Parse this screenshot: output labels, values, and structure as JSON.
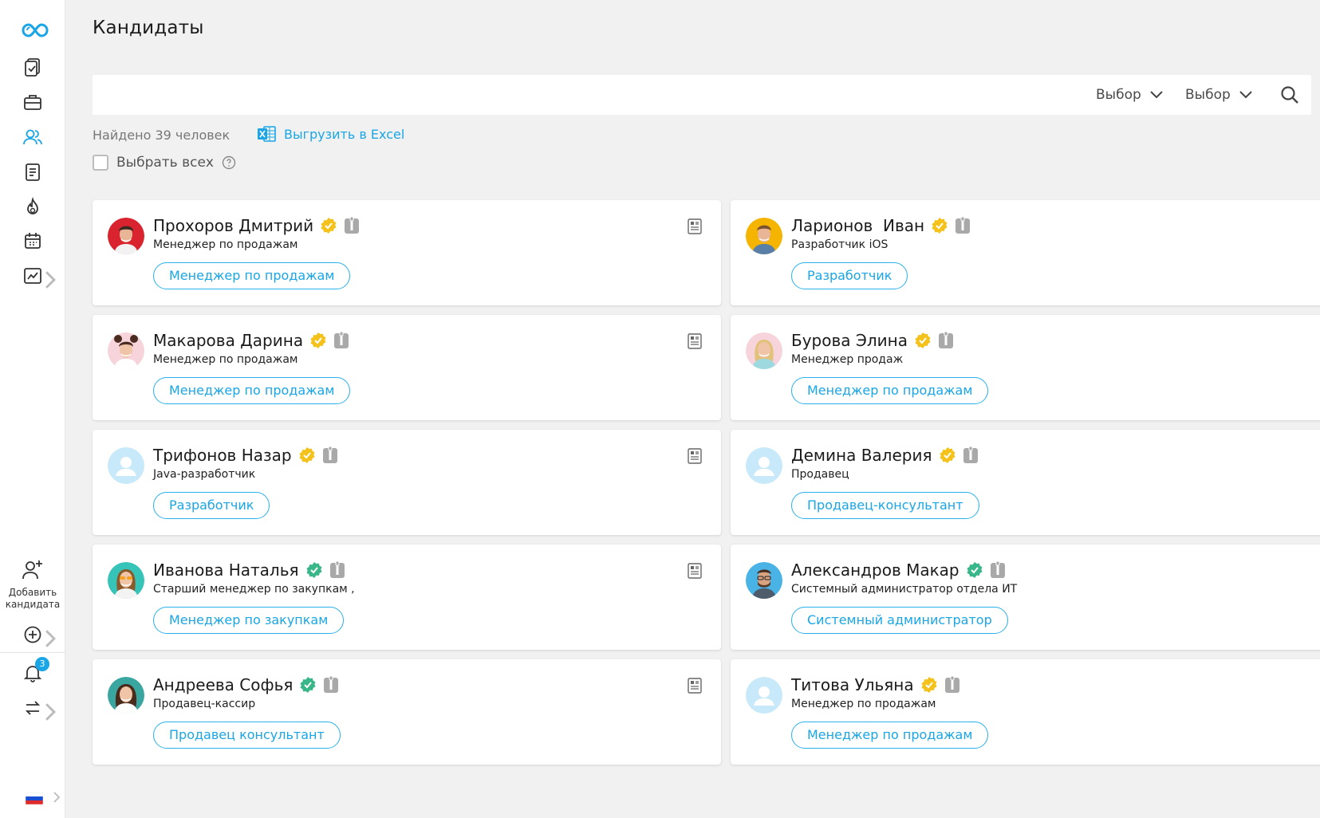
{
  "page": {
    "title": "Кандидаты"
  },
  "search": {
    "placeholder": "",
    "select1": "Выбор",
    "select2": "Выбор"
  },
  "results": {
    "found_text": "Найдено 39 человек",
    "export_label": "Выгрузить в Excel",
    "select_all_label": "Выбрать всех"
  },
  "sidebar": {
    "add_candidate_line1": "Добавить",
    "add_candidate_line2": "кандидата",
    "notifications_count": "3",
    "icons": [
      "logo-icon",
      "documents-icon",
      "briefcase-icon",
      "candidates-icon",
      "file-icon",
      "hot-icon",
      "calendar-icon",
      "analytics-icon"
    ]
  },
  "colors": {
    "accent": "#1aa6e6",
    "gold_badge": "#f4c21b",
    "green_badge": "#3ab78a",
    "background": "#f1f1f1"
  },
  "candidates": [
    {
      "name": "Прохоров Дмитрий",
      "position": "Менеджер по продажам",
      "tag": "Менеджер по продажам",
      "status": "gold",
      "resume": true,
      "avatar": "photo-red"
    },
    {
      "name": "Ларионов  Иван",
      "position": "Разработчик iOS",
      "tag": "Разработчик",
      "status": "gold",
      "resume": false,
      "avatar": "photo-yellow"
    },
    {
      "name": "Макарова Дарина",
      "position": "Менеджер по продажам",
      "tag": "Менеджер по продажам",
      "status": "gold",
      "resume": true,
      "avatar": "photo-pink"
    },
    {
      "name": "Бурова Элина",
      "position": "Менеджер продаж",
      "tag": "Менеджер по продажам",
      "status": "gold",
      "resume": false,
      "avatar": "photo-pink-blonde"
    },
    {
      "name": "Трифонов Назар",
      "position": "Java-разработчик",
      "tag": "Разработчик",
      "status": "gold",
      "resume": true,
      "avatar": "placeholder"
    },
    {
      "name": "Демина Валерия",
      "position": "Продавец",
      "tag": "Продавец-консультант",
      "status": "gold",
      "resume": false,
      "avatar": "placeholder"
    },
    {
      "name": "Иванова Наталья",
      "position": "Старший менеджер по закупкам ,",
      "tag": "Менеджер по закупкам",
      "status": "green",
      "resume": true,
      "avatar": "photo-teal"
    },
    {
      "name": "Александров Макар",
      "position": "Системный администратор отдела ИТ",
      "tag": "Системный администратор",
      "status": "green",
      "resume": false,
      "avatar": "photo-blue-man"
    },
    {
      "name": "Андреева Софья",
      "position": "Продавец-кассир",
      "tag": "Продавец консультант",
      "status": "green",
      "resume": true,
      "avatar": "photo-teal-woman"
    },
    {
      "name": "Титова Ульяна",
      "position": "Менеджер по продажам",
      "tag": "Менеджер по продажам",
      "status": "gold",
      "resume": false,
      "avatar": "placeholder"
    }
  ]
}
